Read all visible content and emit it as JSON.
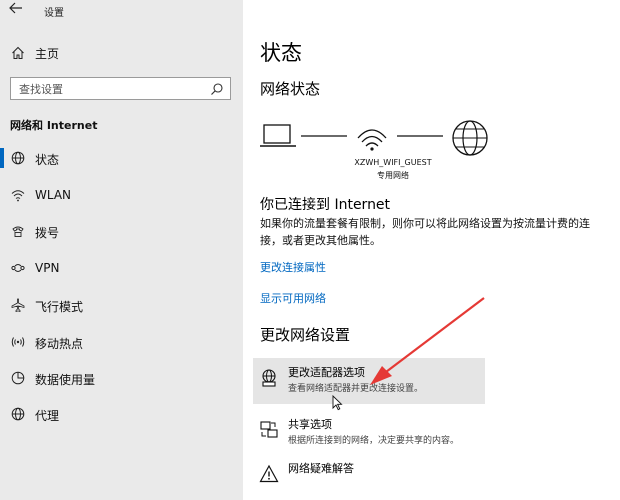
{
  "window": {
    "title": "设置"
  },
  "sidebar": {
    "home": {
      "label": "主页",
      "icon": "home-icon"
    },
    "search": {
      "placeholder": "查找设置"
    },
    "section_title": "网络和 Internet",
    "items": [
      {
        "label": "状态",
        "icon": "globe-status-icon",
        "active": true
      },
      {
        "label": "WLAN",
        "icon": "wifi-icon",
        "active": false
      },
      {
        "label": "拨号",
        "icon": "dialup-icon",
        "active": false
      },
      {
        "label": "VPN",
        "icon": "vpn-icon",
        "active": false
      },
      {
        "label": "飞行模式",
        "icon": "airplane-icon",
        "active": false
      },
      {
        "label": "移动热点",
        "icon": "hotspot-icon",
        "active": false
      },
      {
        "label": "数据使用量",
        "icon": "data-usage-icon",
        "active": false
      },
      {
        "label": "代理",
        "icon": "proxy-globe-icon",
        "active": false
      }
    ]
  },
  "main": {
    "title": "状态",
    "network_status_title": "网络状态",
    "network": {
      "name": "XZWH_WIFI_GUEST",
      "type": "专用网络"
    },
    "connection": {
      "title": "你已连接到 Internet",
      "description": "如果你的流量套餐有限制，则你可以将此网络设置为按流量计费的连接，或者更改其他属性。"
    },
    "links": {
      "change_properties": "更改连接属性",
      "show_networks": "显示可用网络"
    },
    "change_title": "更改网络设置",
    "options": [
      {
        "title": "更改适配器选项",
        "description": "查看网络适配器并更改连接设置。",
        "icon": "adapter-icon"
      },
      {
        "title": "共享选项",
        "description": "根据所连接到的网络，决定要共享的内容。",
        "icon": "sharing-icon"
      },
      {
        "title": "网络疑难解答",
        "description": "",
        "icon": "warning-icon"
      }
    ]
  },
  "colors": {
    "accent": "#0067c0",
    "annotation": "#e53935",
    "sidebar_bg": "#eaeaea"
  }
}
